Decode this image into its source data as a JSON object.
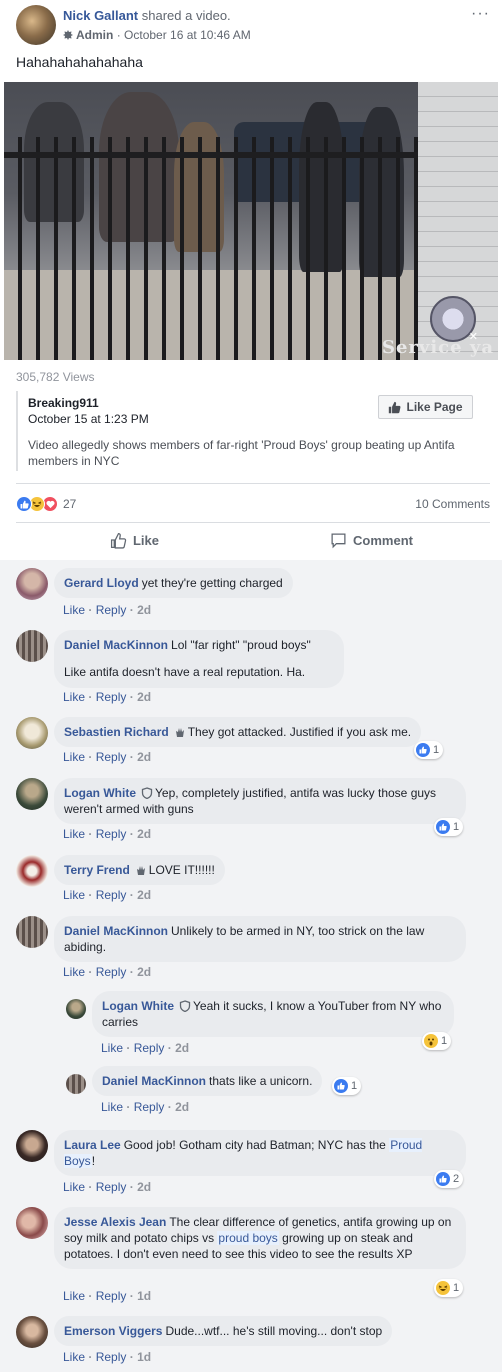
{
  "post": {
    "author": "Nick Gallant",
    "action": "shared a video.",
    "role": "Admin",
    "timestamp": "October 16 at 10:46 AM",
    "more_icon": "···",
    "text": "Hahahahahahahaha",
    "video_watermark": "Service ya",
    "views": "305,782 Views"
  },
  "shared": {
    "source": "Breaking911",
    "date": "October 15 at 1:23 PM",
    "like_page_label": "Like Page",
    "description": "Video allegedly shows members of far-right 'Proud Boys' group beating up Antifa members in NYC"
  },
  "reactions": {
    "types": [
      "like",
      "haha",
      "love"
    ],
    "count": "27",
    "comments_label": "10 Comments"
  },
  "actions": {
    "like_label": "Like",
    "comment_label": "Comment"
  },
  "comment_actions": {
    "like": "Like",
    "reply": "Reply",
    "separator": "·"
  },
  "comments": [
    {
      "name": "Gerard Lloyd",
      "text": "yet they're getting charged",
      "time": "2d",
      "reactions": null
    },
    {
      "name": "Daniel MacKinnon",
      "text": "Lol \"far right\" \"proud boys\"",
      "text2": "Like antifa doesn't have a real reputation. Ha.",
      "time": "2d",
      "reactions": null
    },
    {
      "name": "Sebastien Richard",
      "text": "They got attacked. Justified if you ask me.",
      "time": "2d",
      "reactions": {
        "type": "like",
        "count": "1"
      }
    },
    {
      "name": "Logan White",
      "text": "Yep, completely justified, antifa was lucky those guys weren't armed with guns",
      "time": "2d",
      "reactions": {
        "type": "like",
        "count": "1"
      }
    },
    {
      "name": "Terry Frend",
      "text": "LOVE IT!!!!!!",
      "time": "2d",
      "reactions": null
    },
    {
      "name": "Daniel MacKinnon",
      "text": "Unlikely to be armed in NY, too strick on the law abiding.",
      "time": "2d",
      "reactions": null
    },
    {
      "name": "Logan White",
      "text": "Yeah it sucks, I know a YouTuber from NY who carries",
      "time": "2d",
      "reactions": {
        "type": "wow",
        "count": "1"
      },
      "reply": true
    },
    {
      "name": "Daniel MacKinnon",
      "text": "thats like a unicorn.",
      "time": "2d",
      "reactions": {
        "type": "like",
        "count": "1"
      },
      "reply": true
    },
    {
      "name": "Laura Lee",
      "text_before": "Good job! Gotham city had Batman; NYC has the",
      "highlight": "Proud Boys",
      "text_after": "!",
      "time": "2d",
      "reactions": {
        "type": "like",
        "count": "2"
      }
    },
    {
      "name": "Jesse Alexis Jean",
      "text_before": "The clear difference of genetics, antifa growing up on soy milk and potato chips vs",
      "highlight": "proud boys",
      "text_after": "growing up on steak and potatoes. I don't even need to see this video to see the results XP",
      "time": "1d",
      "reactions": {
        "type": "haha",
        "count": "1"
      }
    },
    {
      "name": "Emerson Viggers",
      "text": "Dude...wtf... he's still moving... don't stop",
      "time": "1d",
      "reactions": null
    }
  ],
  "colors": {
    "link": "#385898",
    "bubble": "#e9ebee",
    "comment_bg": "#f2f3f5",
    "like_blue": "#3b7bf0"
  }
}
